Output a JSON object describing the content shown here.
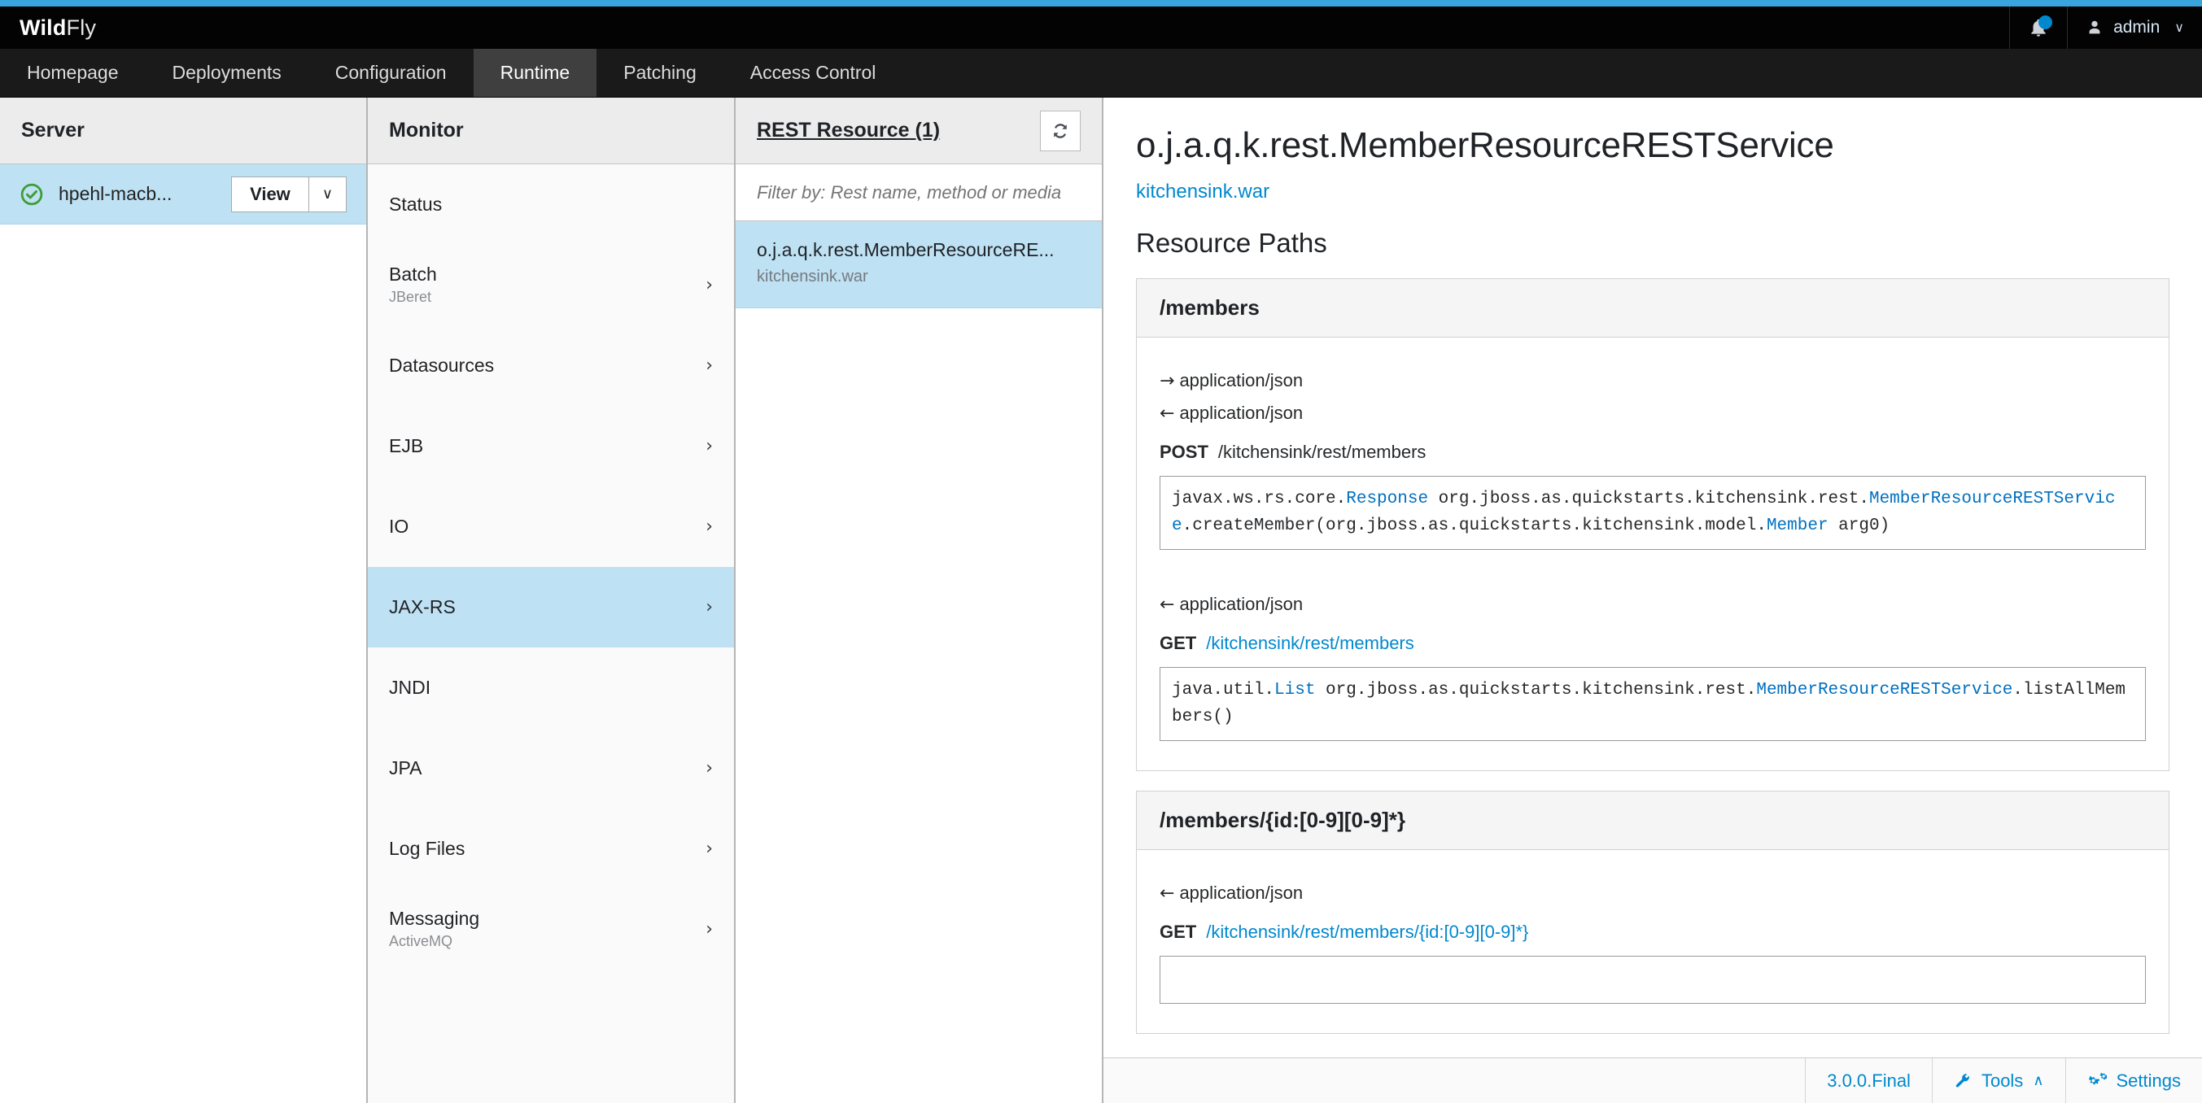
{
  "brand": {
    "bold": "Wild",
    "light": "Fly"
  },
  "header": {
    "notifications_icon": "bell-icon",
    "user_icon": "user-icon",
    "username": "admin",
    "user_caret": "∨"
  },
  "nav": {
    "items": [
      {
        "label": "Homepage",
        "active": false
      },
      {
        "label": "Deployments",
        "active": false
      },
      {
        "label": "Configuration",
        "active": false
      },
      {
        "label": "Runtime",
        "active": true
      },
      {
        "label": "Patching",
        "active": false
      },
      {
        "label": "Access Control",
        "active": false
      }
    ]
  },
  "server_column": {
    "title": "Server",
    "row": {
      "status_icon": "check-circle-icon",
      "name": "hpehl-macb...",
      "view_label": "View",
      "caret": "∨"
    }
  },
  "monitor_column": {
    "title": "Monitor",
    "items": [
      {
        "label": "Status",
        "sub": "",
        "chevron": false,
        "selected": false
      },
      {
        "label": "Batch",
        "sub": "JBeret",
        "chevron": true,
        "selected": false
      },
      {
        "label": "Datasources",
        "sub": "",
        "chevron": true,
        "selected": false
      },
      {
        "label": "EJB",
        "sub": "",
        "chevron": true,
        "selected": false
      },
      {
        "label": "IO",
        "sub": "",
        "chevron": true,
        "selected": false
      },
      {
        "label": "JAX-RS",
        "sub": "",
        "chevron": true,
        "selected": true
      },
      {
        "label": "JNDI",
        "sub": "",
        "chevron": false,
        "selected": false
      },
      {
        "label": "JPA",
        "sub": "",
        "chevron": true,
        "selected": false
      },
      {
        "label": "Log Files",
        "sub": "",
        "chevron": true,
        "selected": false
      },
      {
        "label": "Messaging",
        "sub": "ActiveMQ",
        "chevron": true,
        "selected": false
      }
    ]
  },
  "rest_column": {
    "title": "REST Resource",
    "count": "(1)",
    "refresh_icon": "refresh-icon",
    "filter_placeholder": "Filter by: Rest name, method or media",
    "filter_value": "",
    "items": [
      {
        "name": "o.j.a.q.k.rest.MemberResourceRE...",
        "deployment": "kitchensink.war",
        "selected": true
      }
    ]
  },
  "main": {
    "title": "o.j.a.q.k.rest.MemberResourceRESTService",
    "deployment_link": "kitchensink.war",
    "section_title": "Resource Paths",
    "panels": [
      {
        "path": "/members",
        "entries": [
          {
            "kind": "media",
            "arrow": "→",
            "text": "application/json"
          },
          {
            "kind": "media",
            "arrow": "←",
            "text": "application/json"
          },
          {
            "kind": "method",
            "verb": "POST",
            "path": "/kitchensink/rest/members",
            "link": false
          },
          {
            "kind": "code",
            "parts": [
              {
                "t": "javax.ws.rs.core.",
                "cls": false
              },
              {
                "t": "Response",
                "cls": true
              },
              {
                "t": " org.jboss.as.quickstarts.kitchensink.rest.",
                "cls": false
              },
              {
                "t": "MemberResourceRESTService",
                "cls": true
              },
              {
                "t": ".createMember(org.jboss.as.quickstarts.kitchensink.model.",
                "cls": false
              },
              {
                "t": "Member",
                "cls": true
              },
              {
                "t": " arg0)",
                "cls": false
              }
            ]
          },
          {
            "kind": "spacer"
          },
          {
            "kind": "media",
            "arrow": "←",
            "text": "application/json"
          },
          {
            "kind": "method",
            "verb": "GET",
            "path": "/kitchensink/rest/members",
            "link": true
          },
          {
            "kind": "code",
            "parts": [
              {
                "t": "java.util.",
                "cls": false
              },
              {
                "t": "List",
                "cls": true
              },
              {
                "t": " org.jboss.as.quickstarts.kitchensink.rest.",
                "cls": false
              },
              {
                "t": "MemberResourceRESTService",
                "cls": true
              },
              {
                "t": ".listAllMembers()",
                "cls": false
              }
            ]
          }
        ]
      },
      {
        "path": "/members/{id:[0-9][0-9]*}",
        "entries": [
          {
            "kind": "media",
            "arrow": "←",
            "text": "application/json"
          },
          {
            "kind": "method",
            "verb": "GET",
            "path": "/kitchensink/rest/members/{id:[0-9][0-9]*}",
            "link": true
          },
          {
            "kind": "code",
            "parts": [
              {
                "t": "",
                "cls": false
              }
            ]
          }
        ]
      }
    ]
  },
  "footer": {
    "version": "3.0.0.Final",
    "tools_icon": "wrench-icon",
    "tools_label": "Tools",
    "tools_caret": "∧",
    "settings_icon": "gears-icon",
    "settings_label": "Settings"
  },
  "colors": {
    "accent": "#39a5dc",
    "link": "#0088ce",
    "selection": "#bee1f4",
    "status_ok": "#3f9c35",
    "header_bg": "#030303",
    "nav_bg": "#1a1a1a",
    "nav_active_bg": "#3f3f3f"
  }
}
